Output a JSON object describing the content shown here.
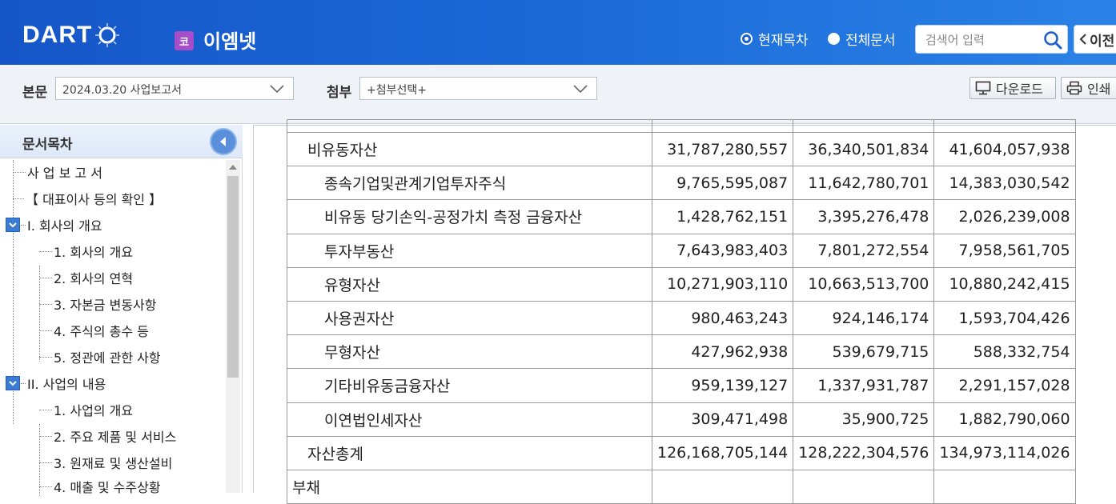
{
  "header": {
    "logo_text": "DART",
    "company_badge": "코",
    "company_name": "이엠넷",
    "radio_current": "현재목차",
    "radio_all": "전체문서",
    "search_placeholder": "검색어 입력",
    "prev_label": "이전"
  },
  "toolbar": {
    "main_label": "본문",
    "main_value": "2024.03.20  사업보고서",
    "attach_label": "첨부",
    "attach_value": "+첨부선택+",
    "download_label": "다운로드",
    "print_label": "인쇄"
  },
  "sidebar": {
    "title": "문서목차",
    "items": [
      {
        "label": "사 업 보 고 서"
      },
      {
        "label": "【 대표이사 등의 확인 】"
      },
      {
        "label": "I. 회사의 개요"
      },
      {
        "label": "1. 회사의 개요"
      },
      {
        "label": "2. 회사의 연혁"
      },
      {
        "label": "3. 자본금 변동사항"
      },
      {
        "label": "4. 주식의 총수 등"
      },
      {
        "label": "5. 정관에 관한 사항"
      },
      {
        "label": "II. 사업의 내용"
      },
      {
        "label": "1. 사업의 개요"
      },
      {
        "label": "2. 주요 제품 및 서비스"
      },
      {
        "label": "3. 원재료 및 생산설비"
      },
      {
        "label": "4. 매출 및 수주상황"
      }
    ]
  },
  "table": {
    "rows": [
      {
        "label": "",
        "v1": "",
        "v2": "",
        "v3": ""
      },
      {
        "label": "비유동자산",
        "v1": "31,787,280,557",
        "v2": "36,340,501,834",
        "v3": "41,604,057,938"
      },
      {
        "label": "종속기업및관계기업투자주식",
        "v1": "9,765,595,087",
        "v2": "11,642,780,701",
        "v3": "14,383,030,542"
      },
      {
        "label": "비유동 당기손익-공정가치 측정 금융자산",
        "v1": "1,428,762,151",
        "v2": "3,395,276,478",
        "v3": "2,026,239,008"
      },
      {
        "label": "투자부동산",
        "v1": "7,643,983,403",
        "v2": "7,801,272,554",
        "v3": "7,958,561,705"
      },
      {
        "label": "유형자산",
        "v1": "10,271,903,110",
        "v2": "10,663,513,700",
        "v3": "10,880,242,415"
      },
      {
        "label": "사용권자산",
        "v1": "980,463,243",
        "v2": "924,146,174",
        "v3": "1,593,704,426"
      },
      {
        "label": "무형자산",
        "v1": "427,962,938",
        "v2": "539,679,715",
        "v3": "588,332,754"
      },
      {
        "label": "기타비유동금융자산",
        "v1": "959,139,127",
        "v2": "1,337,931,787",
        "v3": "2,291,157,028"
      },
      {
        "label": "이연법인세자산",
        "v1": "309,471,498",
        "v2": "35,900,725",
        "v3": "1,882,790,060"
      },
      {
        "label": "자산총계",
        "v1": "126,168,705,144",
        "v2": "128,222,304,576",
        "v3": "134,973,114,026"
      },
      {
        "label": "부채",
        "v1": "",
        "v2": "",
        "v3": ""
      }
    ]
  }
}
